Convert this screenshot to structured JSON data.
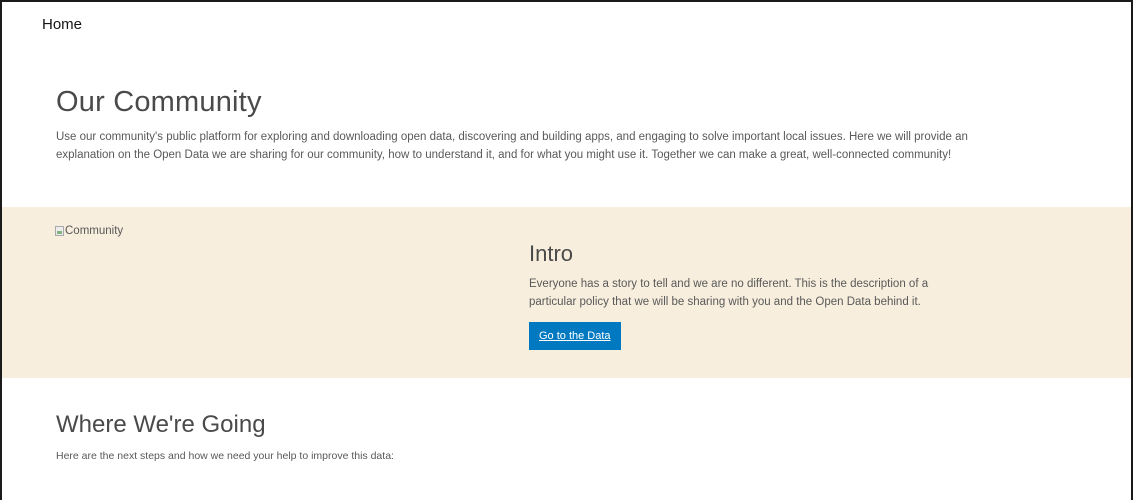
{
  "nav": {
    "home_label": "Home"
  },
  "hero": {
    "title": "Our Community",
    "description": "Use our community's public platform for exploring and downloading open data, discovering and building apps, and engaging to solve important local issues. Here we will provide an explanation on the Open Data we are sharing for our community, how to understand it, and for what you might use it. Together we can make a great, well-connected community!"
  },
  "intro_section": {
    "image_alt": "Community",
    "title": "Intro",
    "description": "Everyone has a story to tell and we are no different. This is the description of a particular policy that we will be sharing with you and the Open Data behind it.",
    "button_label": "Go to the Data"
  },
  "going_section": {
    "title": "Where We're Going",
    "description": "Here are the next steps and how we need your help to improve this data:"
  },
  "colors": {
    "band_background": "#f7eedd",
    "button_background": "#0079c1",
    "button_text": "#ffffff"
  },
  "icons": {
    "broken_image": "broken-image-icon"
  }
}
